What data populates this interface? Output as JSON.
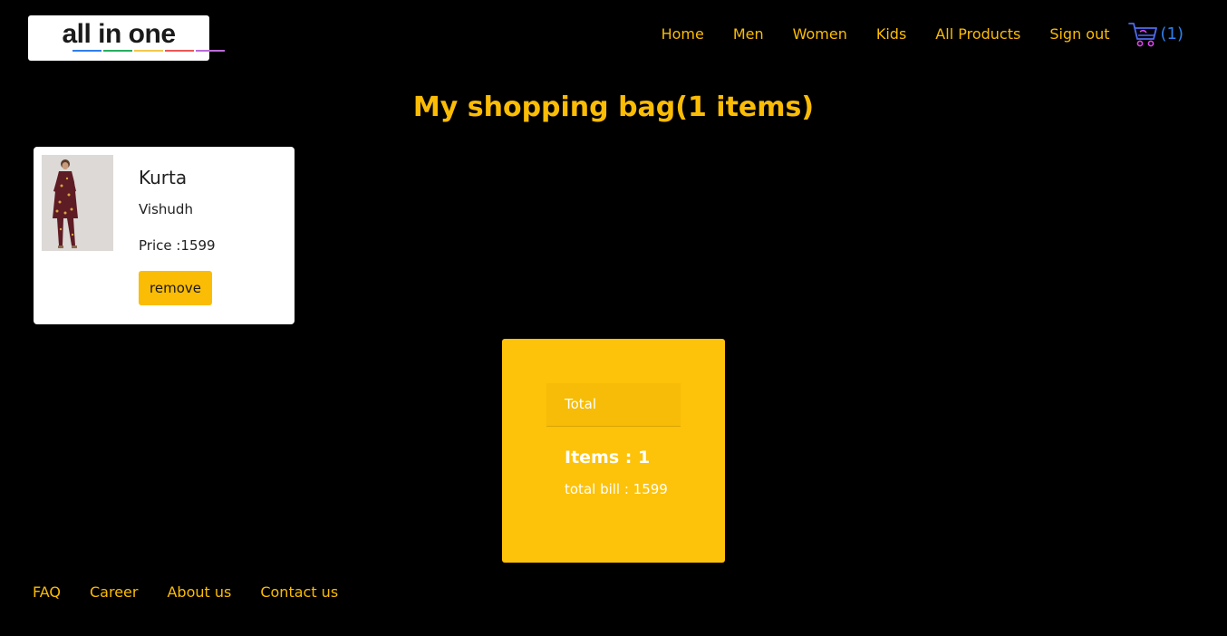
{
  "header": {
    "logo_text": "all in one",
    "logo_bar_colors": [
      "#2f80ed",
      "#27ae60",
      "#f2c94c",
      "#eb5757",
      "#bb6bd9"
    ],
    "nav": [
      {
        "label": "Home"
      },
      {
        "label": "Men"
      },
      {
        "label": "Women"
      },
      {
        "label": "Kids"
      },
      {
        "label": "All Products"
      },
      {
        "label": "Sign out"
      }
    ],
    "cart": {
      "icon": "shopping-cart-icon",
      "count": "(1)"
    }
  },
  "main": {
    "title": "My shopping bag(1 items)",
    "items": [
      {
        "name": "Kurta",
        "brand": "Vishudh",
        "price": "Price :1599",
        "remove_label": "remove",
        "image": "kurta-product-image"
      }
    ]
  },
  "summary": {
    "heading": "Total",
    "items": "Items : 1",
    "total_bill": "total bill : 1599"
  },
  "footer": {
    "links": [
      {
        "label": "FAQ"
      },
      {
        "label": "Career"
      },
      {
        "label": "About us"
      },
      {
        "label": "Contact us"
      }
    ]
  },
  "colors": {
    "background": "#000000",
    "accent": "#fbbc05",
    "cart_count": "#2f80ed",
    "summary_bg": "#fdc20a"
  }
}
